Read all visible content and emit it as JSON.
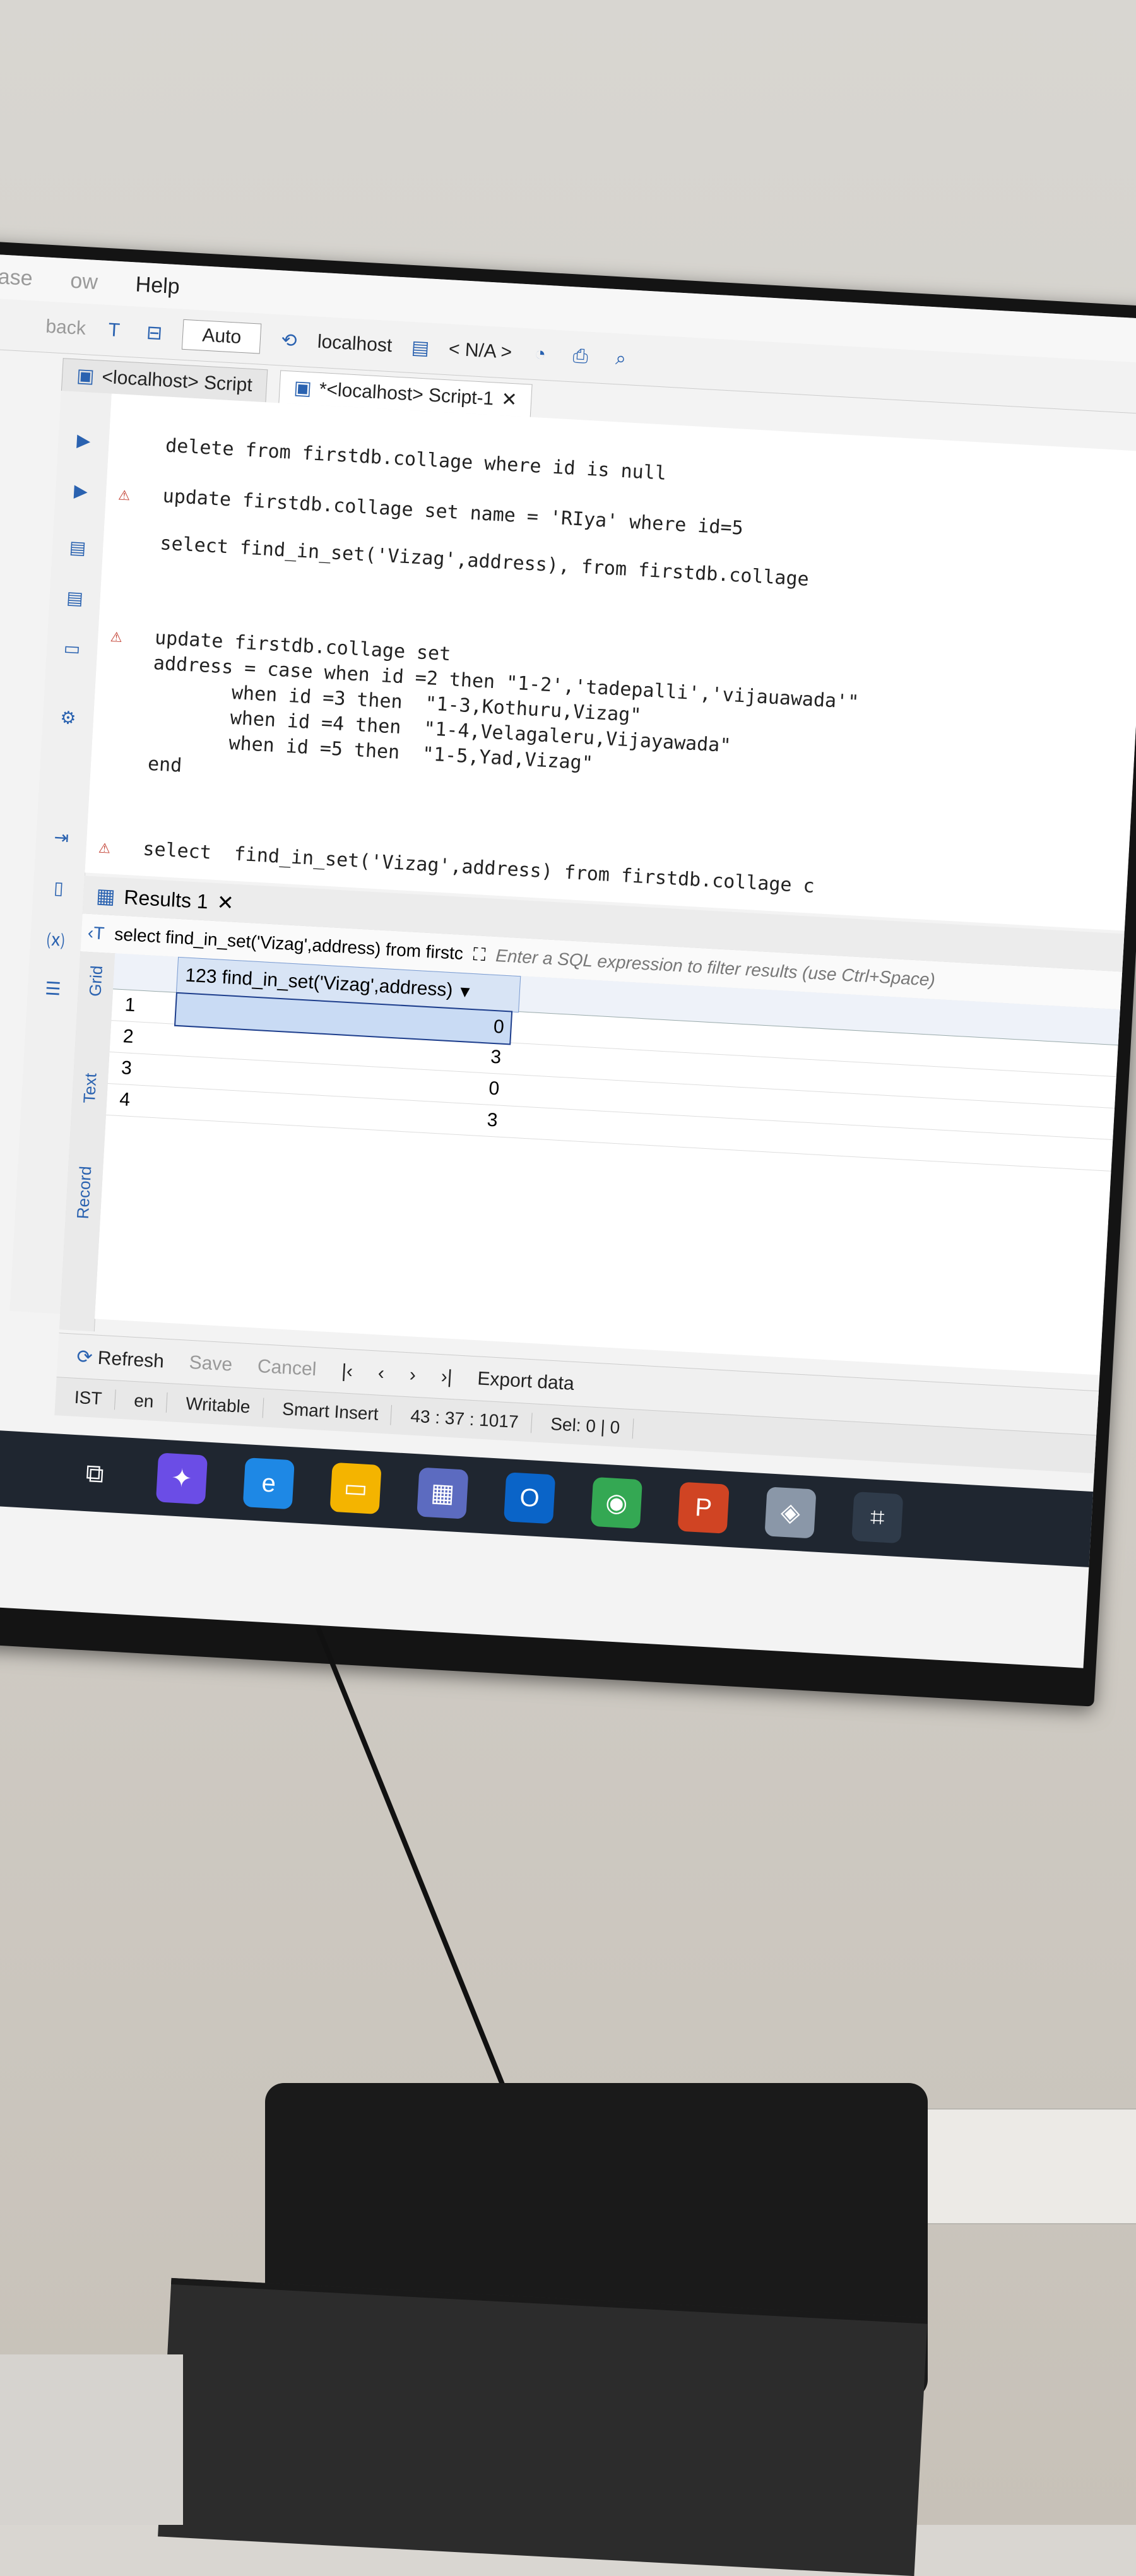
{
  "menu": {
    "items": [
      "ase",
      "ow",
      "Help"
    ],
    "back": "back"
  },
  "toolbar": {
    "auto": "Auto",
    "connection": "localhost",
    "schema": "< N/A >"
  },
  "tabs": [
    {
      "label": "<localhost> Script"
    },
    {
      "label": "*<localhost> Script-1"
    }
  ],
  "editor": {
    "lines": [
      "delete from firstdb.collage where id is null",
      "update firstdb.collage set name = 'RIya' where id=5",
      "select find_in_set('Vizag',address), from firstdb.collage",
      "update firstdb.collage set",
      "address = case when id =2 then \"1-2','tadepalli','vijauawada'\"",
      "       when id =3 then  \"1-3,Kothuru,Vizag\"",
      "       when id =4 then  \"1-4,Velagaleru,Vijayawada\"",
      "       when id =5 then  \"1-5,Yad,Vizag\"",
      "end",
      "select  find_in_set('Vizag',address) from firstdb.collage c"
    ]
  },
  "results": {
    "tab_label": "Results 1",
    "query": "select find_in_set('Vizag',address) from firstc",
    "filter_placeholder": "Enter a SQL expression to filter results (use Ctrl+Space)",
    "column": "123 find_in_set('Vizag',address)",
    "rows": [
      {
        "num": "1",
        "value": "0"
      },
      {
        "num": "2",
        "value": "3"
      },
      {
        "num": "3",
        "value": "0"
      },
      {
        "num": "4",
        "value": "3"
      }
    ],
    "side_tabs": [
      "Grid",
      "Text",
      "Record"
    ]
  },
  "bottom": {
    "refresh": "Refresh",
    "save": "Save",
    "cancel": "Cancel",
    "export": "Export data"
  },
  "status": {
    "tz": "IST",
    "lang": "en",
    "mode": "Writable",
    "insert": "Smart Insert",
    "pos": "43 : 37 : 1017",
    "sel": "Sel: 0 | 0"
  },
  "colors": {
    "accent": "#2a62b0",
    "keyword": "#7b1e5a",
    "string": "#1a7b2b"
  }
}
